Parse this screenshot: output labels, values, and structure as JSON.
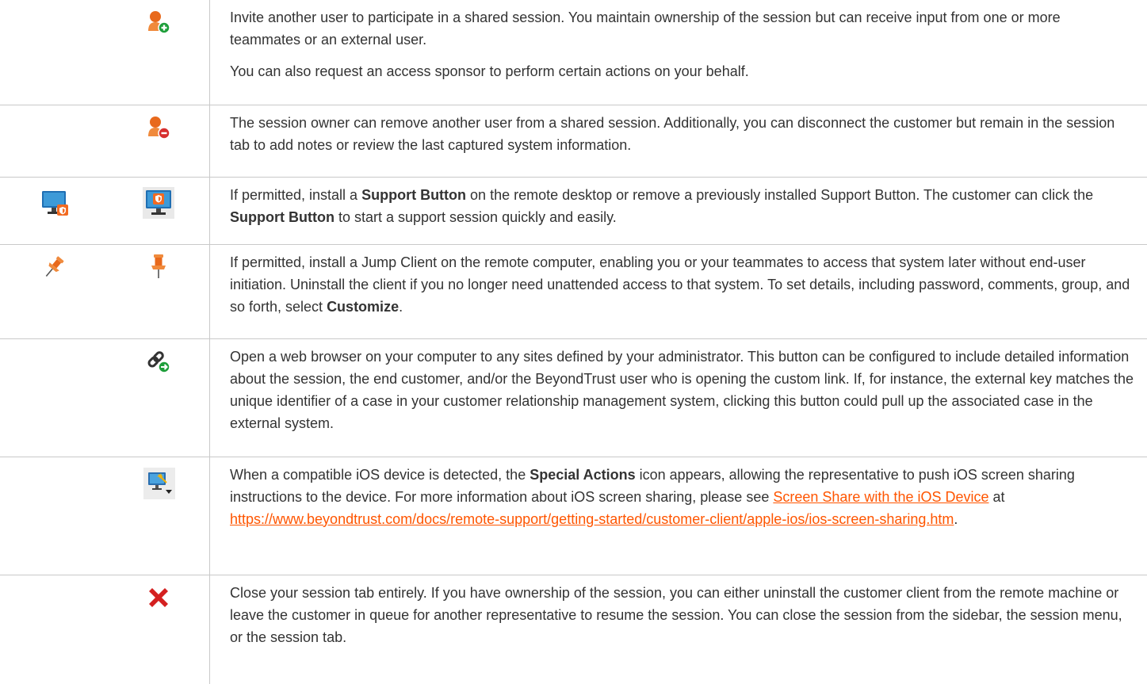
{
  "rows": [
    {
      "icons": [
        "add-user-icon"
      ],
      "paragraphs": [
        "Invite another user to participate in a shared session. You maintain ownership of the session but can receive input from one or more teammates or an external user.",
        "You can also request an access sponsor to perform certain actions on your behalf."
      ]
    },
    {
      "icons": [
        "remove-user-icon"
      ],
      "paragraphs": [
        "The session owner can remove another user from a shared session. Additionally, you can disconnect the customer but remain in the session tab to add notes or review the last captured system information."
      ]
    },
    {
      "icons": [
        "install-support-button-icon",
        "remove-support-button-icon"
      ],
      "p1_a": "If permitted, install a ",
      "p1_b": "Support Button",
      "p1_c": " on the remote desktop or remove a previously installed Support Button. The customer can click the ",
      "p1_d": "Support Button",
      "p1_e": " to start a support session quickly and easily."
    },
    {
      "icons": [
        "install-jump-client-icon",
        "uninstall-jump-client-icon"
      ],
      "p1_a": "If permitted, install a Jump Client on the remote computer, enabling you or your teammates to access that system later without end-user initiation. Uninstall the client if you no longer need unattended access to that system. To set details, including password, comments, group, and so forth, select ",
      "p1_b": "Customize",
      "p1_c": "."
    },
    {
      "icons": [
        "custom-link-icon"
      ],
      "paragraphs": [
        "Open a web browser on your computer to any sites defined by your administrator. This button can be configured to include detailed information about the session, the end customer, and/or the BeyondTrust user who is opening the custom link. If, for instance, the external key matches the unique identifier of a case in your customer relationship management system, clicking this button could pull up the associated case in the external system."
      ]
    },
    {
      "icons": [
        "special-actions-icon"
      ],
      "p1_a": "When a compatible iOS device is detected, the ",
      "p1_b": "Special Actions",
      "p1_c": " icon appears, allowing the representative to push iOS screen sharing instructions to the device. For more information about iOS screen sharing, please see ",
      "link1": "Screen Share with the iOS Device",
      "p1_d": " at ",
      "link2": "https://www.beyondtrust.com/docs/remote-support/getting-started/customer-client/apple-ios/ios-screen-sharing.htm",
      "p1_e": "."
    },
    {
      "icons": [
        "close-session-icon"
      ],
      "paragraphs": [
        "Close your session tab entirely. If you have ownership of the session, you can either uninstall the customer client from the remote machine or leave the customer in queue for another representative to resume the session. You can close the session from the sidebar, the session menu, or the session tab."
      ]
    }
  ],
  "colors": {
    "text": "#333333",
    "link": "#ff5500",
    "border": "#c9c9c9",
    "user_orange": "#e8691c",
    "add_green": "#1e9e3a",
    "remove_red": "#d72f2f",
    "close_red": "#d42020"
  }
}
